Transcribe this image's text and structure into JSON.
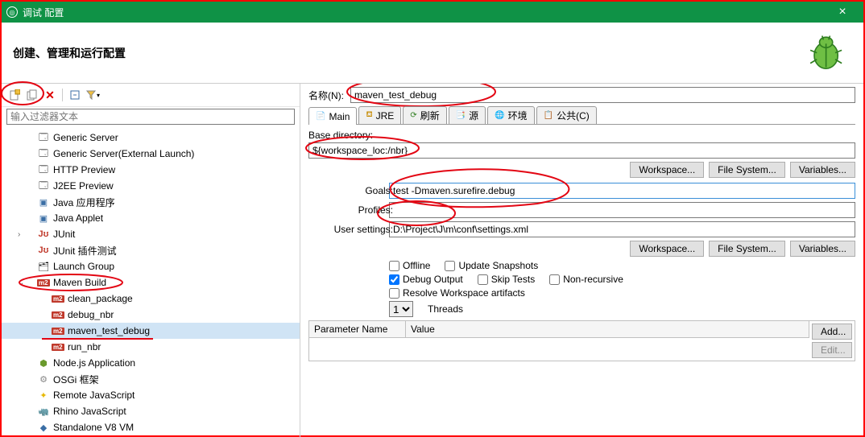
{
  "title": "调试 配置",
  "subtitle": "创建、管理和运行配置",
  "filter_placeholder": "输入过滤器文本",
  "tree": [
    {
      "icon": "srv",
      "label": "Generic Server"
    },
    {
      "icon": "srv",
      "label": "Generic Server(External Launch)"
    },
    {
      "icon": "srv",
      "label": "HTTP Preview"
    },
    {
      "icon": "srv",
      "label": "J2EE Preview"
    },
    {
      "icon": "jav",
      "label": "Java 应用程序"
    },
    {
      "icon": "jav",
      "label": "Java Applet"
    },
    {
      "icon": "ju",
      "label": "JUnit",
      "expandable": true
    },
    {
      "icon": "jup",
      "label": "JUnit 插件测试"
    },
    {
      "icon": "lg",
      "label": "Launch Group"
    },
    {
      "icon": "m2",
      "label": "Maven Build",
      "expandable": true,
      "open": true,
      "ann": "circled"
    },
    {
      "icon": "m2",
      "label": "clean_package",
      "depth": 1
    },
    {
      "icon": "m2",
      "label": "debug_nbr",
      "depth": 1
    },
    {
      "icon": "m2",
      "label": "maven_test_debug",
      "depth": 1,
      "sel": true,
      "ann": "underline"
    },
    {
      "icon": "m2",
      "label": "run_nbr",
      "depth": 1
    },
    {
      "icon": "njs",
      "label": "Node.js Application"
    },
    {
      "icon": "osgi",
      "label": "OSGi 框架"
    },
    {
      "icon": "rjs",
      "label": "Remote JavaScript"
    },
    {
      "icon": "rhi",
      "label": "Rhino JavaScript"
    },
    {
      "icon": "v8",
      "label": "Standalone V8 VM"
    }
  ],
  "form": {
    "name_label": "名称(N):",
    "name_value": "maven_test_debug",
    "tabs": [
      "Main",
      "JRE",
      "刷新",
      "源",
      "环境",
      "公共(C)"
    ],
    "base_dir_label": "Base directory:",
    "base_dir_value": "${workspace_loc:/nbr}",
    "btn_ws": "Workspace...",
    "btn_fs": "File System...",
    "btn_var": "Variables...",
    "goals_label": "Goals:",
    "goals_value": "test -Dmaven.surefire.debug",
    "profiles_label": "Profiles:",
    "profiles_value": "",
    "usersettings_label": "User settings:",
    "usersettings_value": "D:\\Project\\J\\m\\conf\\settings.xml",
    "chk_offline": "Offline",
    "chk_update": "Update Snapshots",
    "chk_debugout": "Debug Output",
    "chk_skiptests": "Skip Tests",
    "chk_nonrec": "Non-recursive",
    "chk_resolve": "Resolve Workspace artifacts",
    "threads_label": "Threads",
    "threads_value": "1",
    "col_param": "Parameter Name",
    "col_value": "Value",
    "btn_add": "Add...",
    "btn_edit": "Edit..."
  }
}
